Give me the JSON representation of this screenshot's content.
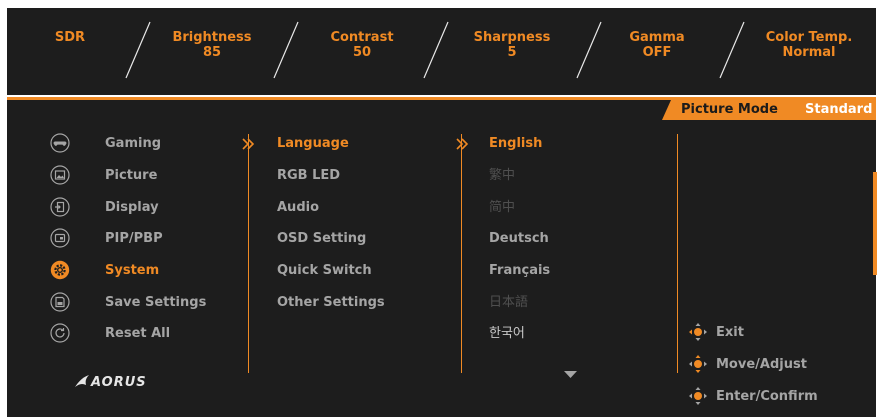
{
  "top_bar": {
    "items": [
      {
        "label": "SDR",
        "value": ""
      },
      {
        "label": "Brightness",
        "value": "85"
      },
      {
        "label": "Contrast",
        "value": "50"
      },
      {
        "label": "Sharpness",
        "value": "5"
      },
      {
        "label": "Gamma",
        "value": "OFF"
      },
      {
        "label": "Color Temp.",
        "value": "Normal"
      }
    ]
  },
  "picture_mode": {
    "label": "Picture Mode",
    "value": "Standard"
  },
  "menu": {
    "categories": [
      {
        "label": "Gaming",
        "icon": "gamepad-icon"
      },
      {
        "label": "Picture",
        "icon": "picture-icon"
      },
      {
        "label": "Display",
        "icon": "display-input-icon"
      },
      {
        "label": "PIP/PBP",
        "icon": "pip-icon"
      },
      {
        "label": "System",
        "icon": "gear-icon",
        "selected": true
      },
      {
        "label": "Save Settings",
        "icon": "save-icon"
      },
      {
        "label": "Reset All",
        "icon": "reset-icon"
      }
    ],
    "submenu": [
      {
        "label": "Language",
        "selected": true
      },
      {
        "label": "RGB LED"
      },
      {
        "label": "Audio"
      },
      {
        "label": "OSD Setting"
      },
      {
        "label": "Quick Switch"
      },
      {
        "label": "Other Settings"
      }
    ],
    "options": [
      {
        "label": "English",
        "selected": true
      },
      {
        "label": "繁中"
      },
      {
        "label": "简中"
      },
      {
        "label": "Deutsch"
      },
      {
        "label": "Français"
      },
      {
        "label": "日本語"
      },
      {
        "label": "한국어"
      }
    ]
  },
  "help": {
    "exit": "Exit",
    "move": "Move/Adjust",
    "enter": "Enter/Confirm"
  },
  "brand": {
    "logo": "AORUS"
  },
  "colors": {
    "accent": "#f08a24",
    "panel": "#1d1d1d",
    "text": "#a5a5a5"
  }
}
